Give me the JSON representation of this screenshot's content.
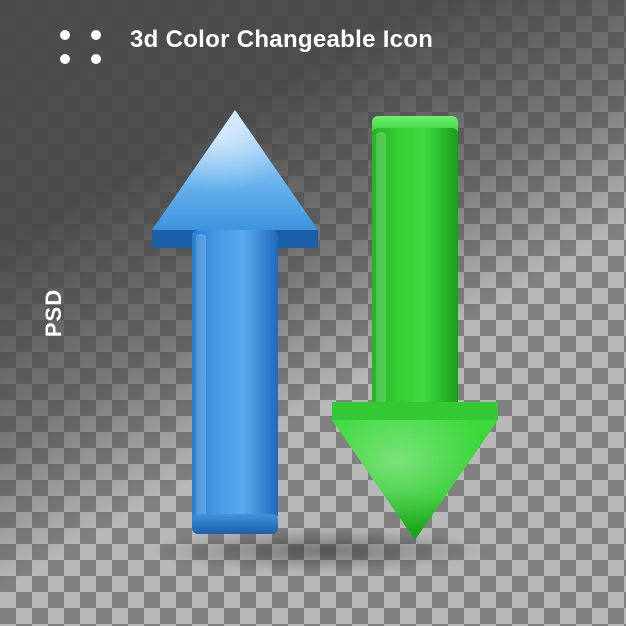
{
  "title": "3d Color Changeable Icon",
  "format_label": "PSD",
  "icons": {
    "up_arrow": "up-arrow-icon",
    "down_arrow": "down-arrow-icon",
    "dots": "dots-decoration"
  },
  "colors": {
    "up_arrow_light": "#9ed0f6",
    "up_arrow_mid": "#3e94dd",
    "up_arrow_dark": "#1e6bbf",
    "down_arrow_light": "#5be85b",
    "down_arrow_mid": "#2ecc2e",
    "down_arrow_dark": "#1a9e1a",
    "text": "#ffffff"
  }
}
